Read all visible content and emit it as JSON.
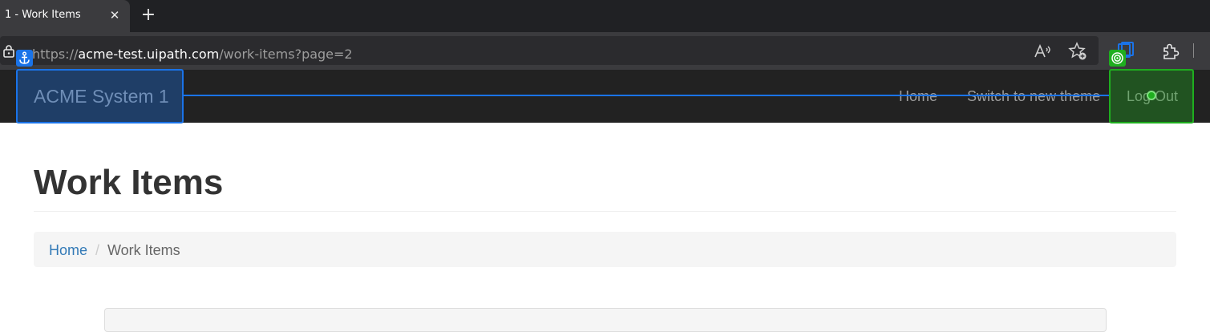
{
  "browser": {
    "tab": {
      "title": "1 - Work Items",
      "close_icon": "close-icon"
    },
    "new_tab_icon": "plus-icon",
    "address_bar": {
      "scheme": "https://",
      "host": "acme-test.uipath.com",
      "path": "/work-items?page=2"
    },
    "toolbar_icons": [
      "read-aloud-icon",
      "favorites-icon",
      "collections-icon",
      "extensions-icon"
    ]
  },
  "navbar": {
    "brand": "ACME System 1",
    "links": {
      "home": "Home",
      "theme": "Switch to new theme",
      "logout": "Log Out"
    }
  },
  "page": {
    "title": "Work Items",
    "breadcrumb": {
      "home": "Home",
      "separator": "/",
      "current": "Work Items"
    }
  },
  "overlay": {
    "anchor_color": "#1a73e8",
    "target_color": "#1fae1f",
    "anchor_icon": "anchor-icon",
    "target_icon": "target-icon"
  }
}
